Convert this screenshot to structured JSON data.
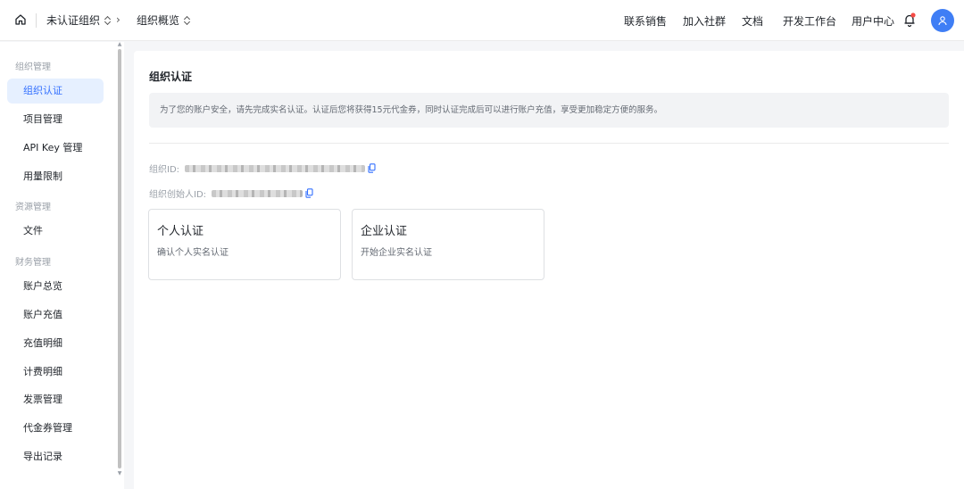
{
  "topbar": {
    "org_selector": "未认证组织",
    "separator": "›",
    "section_selector": "组织概览",
    "nav": [
      "联系销售",
      "加入社群",
      "文档",
      "开发工作台",
      "用户中心"
    ]
  },
  "sidebar": {
    "groups": [
      {
        "title": "组织管理",
        "items": [
          "组织认证",
          "项目管理",
          "API Key 管理",
          "用量限制"
        ]
      },
      {
        "title": "资源管理",
        "items": [
          "文件"
        ]
      },
      {
        "title": "财务管理",
        "items": [
          "账户总览",
          "账户充值",
          "充值明细",
          "计费明细",
          "发票管理",
          "代金券管理",
          "导出记录"
        ]
      }
    ],
    "active_item": "组织认证"
  },
  "main": {
    "title": "组织认证",
    "notice": "为了您的账户安全，请先完成实名认证。认证后您将获得15元代金券，同时认证完成后可以进行账户充值，享受更加稳定方便的服务。",
    "org_id_label": "组织ID:",
    "creator_id_label": "组织创始人ID:",
    "cards": [
      {
        "title": "个人认证",
        "desc": "确认个人实名认证"
      },
      {
        "title": "企业认证",
        "desc": "开始企业实名认证"
      }
    ]
  },
  "colors": {
    "accent": "#3370ff",
    "avatar_bg": "#3f7ef5",
    "active_bg": "#e6f0ff",
    "bell_badge": "#f54a45"
  },
  "icons": {
    "home": "home-icon",
    "bell": "bell-icon",
    "avatar": "user-icon",
    "copy": "copy-icon"
  }
}
